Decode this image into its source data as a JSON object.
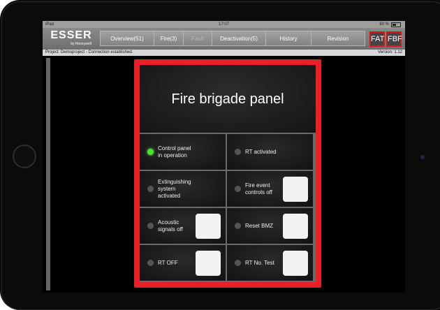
{
  "statusbar": {
    "carrier": "iPad",
    "time": "17:07",
    "battery": "60 %"
  },
  "brand": {
    "name": "ESSER",
    "sub": "by Honeywell"
  },
  "nav": [
    {
      "label": "Overview(51)",
      "disabled": false
    },
    {
      "label": "Fire(3)",
      "disabled": false
    },
    {
      "label": "Fault",
      "disabled": true
    },
    {
      "label": "Deactivation(5)",
      "disabled": false
    },
    {
      "label": "History",
      "disabled": false
    },
    {
      "label": "Revision",
      "disabled": false
    }
  ],
  "fat_label": "FAT",
  "fbf_label": "FBF",
  "project_line": "Project: Demoproject - Connection established.",
  "version": "Version: 1.12",
  "panel": {
    "title": "Fire brigade panel",
    "cells": [
      {
        "label": "Control panel\nin operation",
        "led_on": true,
        "button": false
      },
      {
        "label": "RT activated",
        "led_on": false,
        "button": false
      },
      {
        "label": "Extinguishing\nsystem\nactivated",
        "led_on": false,
        "button": false
      },
      {
        "label": "Fire event\ncontrols off",
        "led_on": false,
        "button": true
      },
      {
        "label": "Acoustic\nsignals off",
        "led_on": false,
        "button": true
      },
      {
        "label": "Reset BMZ",
        "led_on": false,
        "button": true
      },
      {
        "label": "RT OFF",
        "led_on": false,
        "button": true
      },
      {
        "label": "RT No. Test",
        "led_on": false,
        "button": true
      }
    ]
  },
  "colors": {
    "panel_border": "#e8202a",
    "led_on": "#4be03a",
    "fat_border": "#d21a1a"
  }
}
